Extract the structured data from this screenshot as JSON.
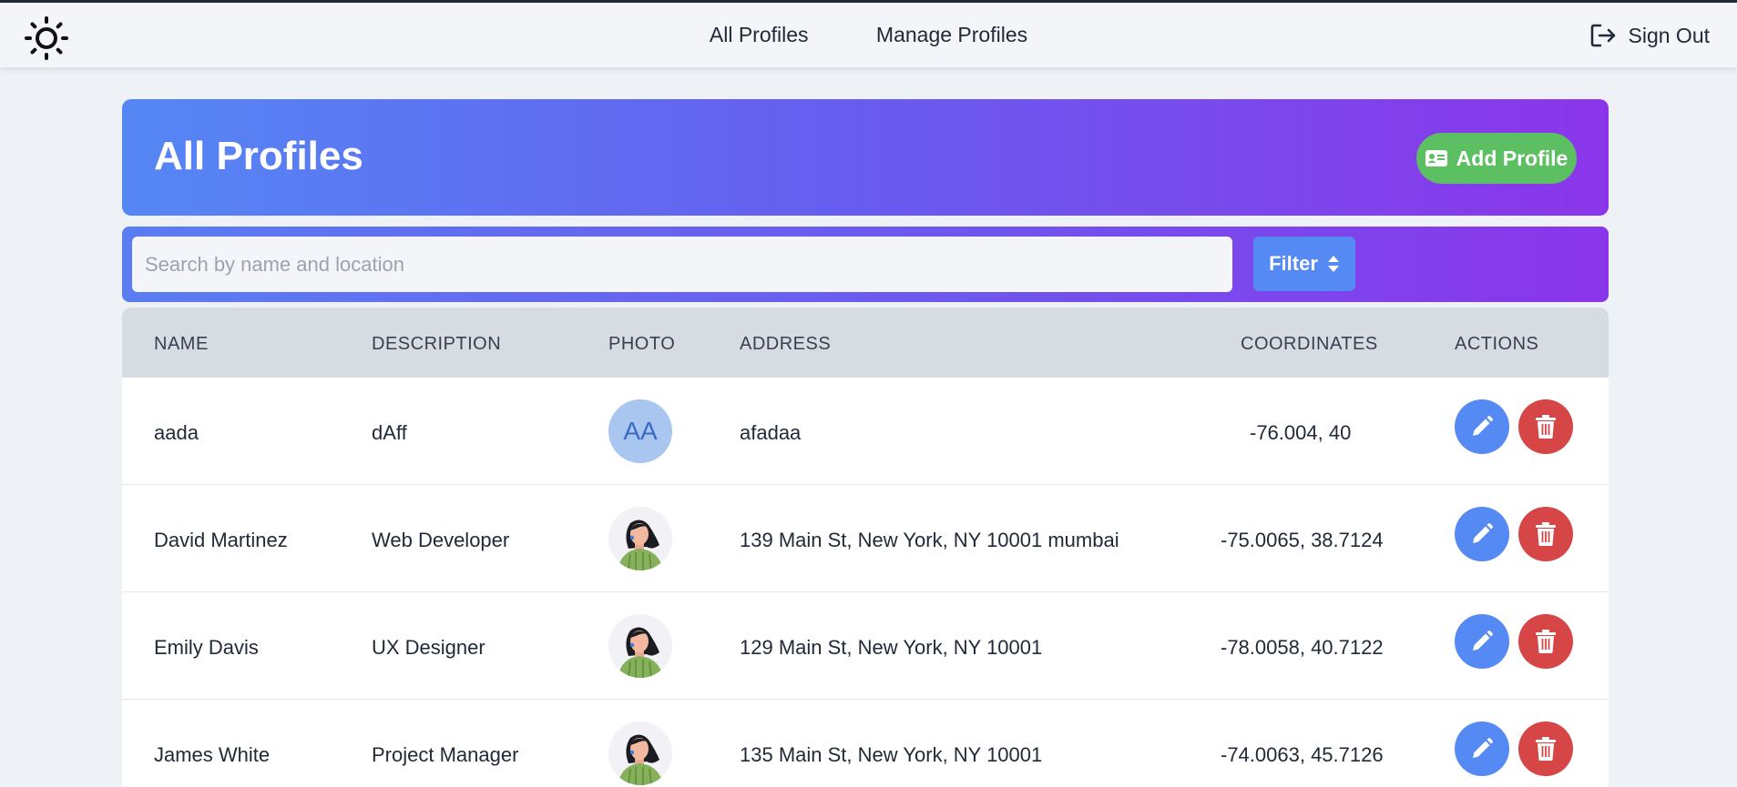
{
  "nav": {
    "theme_icon": "sun-icon",
    "links": [
      "All Profiles",
      "Manage Profiles"
    ],
    "signout_label": "Sign Out",
    "signout_icon": "sign-out-icon"
  },
  "hero": {
    "title": "All Profiles",
    "add_button_label": "Add Profile",
    "add_button_icon": "id-card-icon"
  },
  "search": {
    "placeholder": "Search by name and location",
    "value": "",
    "filter_label": "Filter",
    "filter_icon": "sort-icon"
  },
  "table": {
    "columns": [
      "NAME",
      "DESCRIPTION",
      "PHOTO",
      "ADDRESS",
      "COORDINATES",
      "ACTIONS"
    ],
    "rows": [
      {
        "name": "aada",
        "description": "dAff",
        "photo_initials": "AA",
        "address": "afadaa",
        "coordinates": "-76.004, 40"
      },
      {
        "name": "David Martinez",
        "description": "Web Developer",
        "photo_initials": "",
        "address": "139 Main St, New York, NY 10001 mumbai",
        "coordinates": "-75.0065, 38.7124"
      },
      {
        "name": "Emily Davis",
        "description": "UX Designer",
        "photo_initials": "",
        "address": "129 Main St, New York, NY 10001",
        "coordinates": "-78.0058, 40.7122"
      },
      {
        "name": "James White",
        "description": "Project Manager",
        "photo_initials": "",
        "address": "135 Main St, New York, NY 10001",
        "coordinates": "-74.0063, 45.7126"
      }
    ]
  },
  "colors": {
    "edit": "#5589f3",
    "delete": "#d64646",
    "add": "#5cc062"
  }
}
